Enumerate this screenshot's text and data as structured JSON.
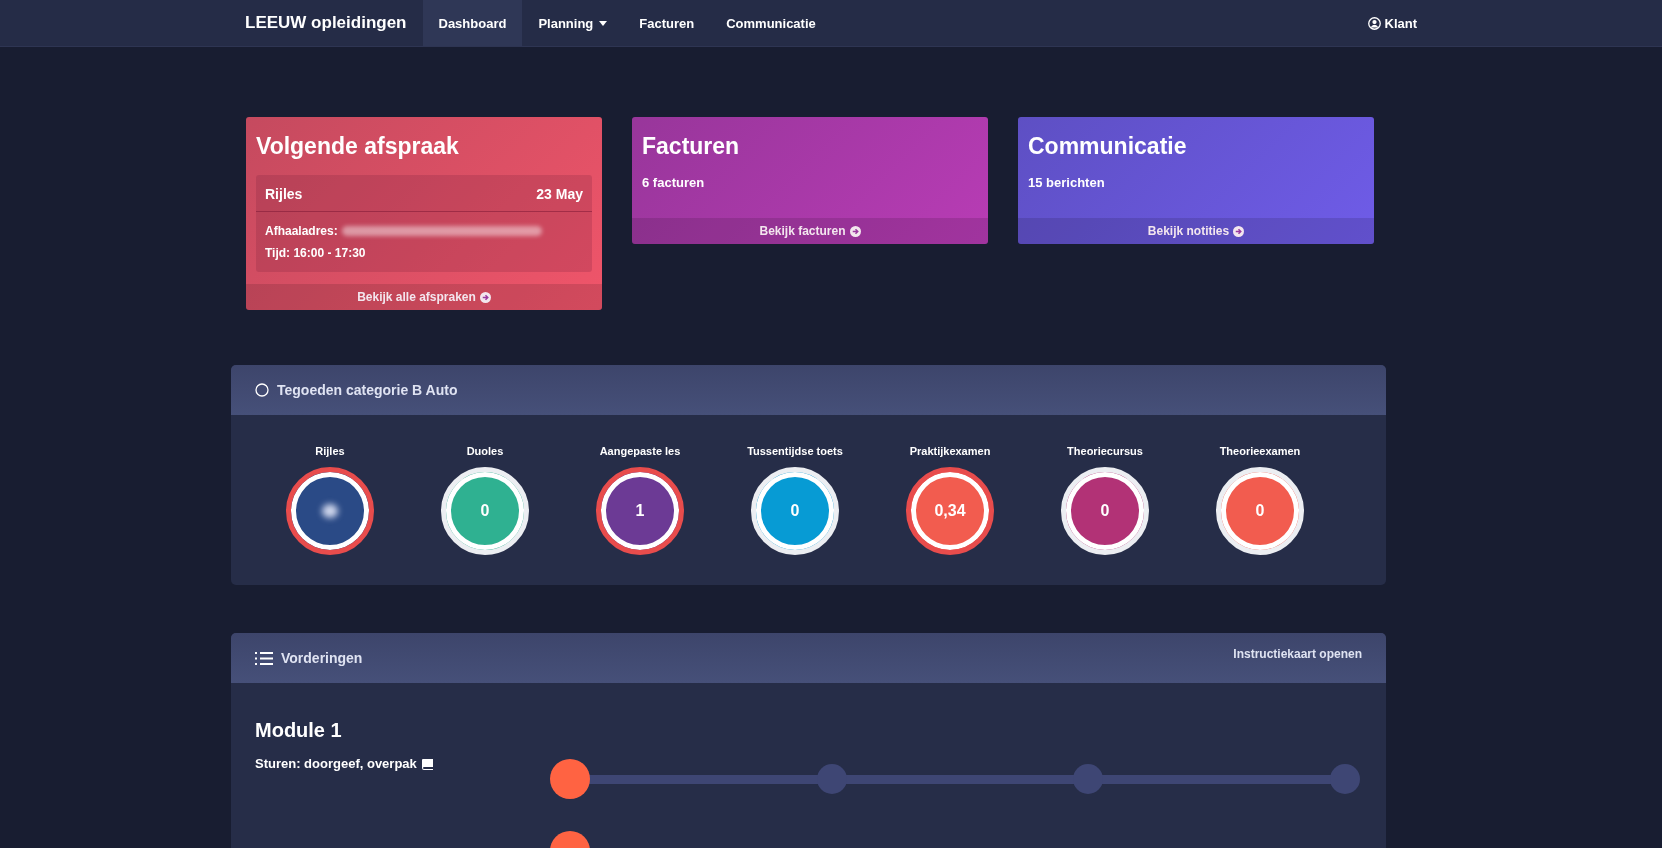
{
  "navbar": {
    "brand": "LEEUW opleidingen",
    "items": [
      {
        "label": "Dashboard",
        "selected": true,
        "dropdown": false
      },
      {
        "label": "Planning",
        "selected": false,
        "dropdown": true
      },
      {
        "label": "Facturen",
        "selected": false,
        "dropdown": false
      },
      {
        "label": "Communicatie",
        "selected": false,
        "dropdown": false
      }
    ],
    "user": "Klant"
  },
  "cards": [
    {
      "kind": "appointment",
      "title": "Volgende afspraak",
      "lesson": "Rijles",
      "date": "23 May",
      "address_label": "Afhaaladres:",
      "time": "Tijd: 16:00 - 17:30",
      "link": "Bekijk alle afspraken",
      "color": "#f0556a"
    },
    {
      "kind": "summary",
      "title": "Facturen",
      "subtitle": "6 facturen",
      "link": "Bekijk facturen",
      "color": "#b83cb5"
    },
    {
      "kind": "summary",
      "title": "Communicatie",
      "subtitle": "15 berichten",
      "link": "Bekijk notities",
      "color": "#6f5ce8"
    }
  ],
  "credits": {
    "title": "Tegoeden categorie B Auto",
    "items": [
      {
        "label": "Rijles",
        "value_blurred": true,
        "color": "#2a4a86",
        "highlighted": true
      },
      {
        "label": "Duoles",
        "value": "0",
        "color": "#2fb191",
        "highlighted": false
      },
      {
        "label": "Aangepaste les",
        "value": "1",
        "color": "#6c3a95",
        "highlighted": true
      },
      {
        "label": "Tussentijdse toets",
        "value": "0",
        "color": "#079bd4",
        "highlighted": false
      },
      {
        "label": "Praktijkexamen",
        "value": "0,34",
        "color": "#f25c4f",
        "highlighted": true
      },
      {
        "label": "Theoriecursus",
        "value": "0",
        "color": "#b23276",
        "highlighted": false
      },
      {
        "label": "Theorieexamen",
        "value": "0",
        "color": "#f25c4f",
        "highlighted": false
      }
    ]
  },
  "progress": {
    "title": "Vorderingen",
    "action": "Instructiekaart openen",
    "modules": [
      {
        "title": "Module 1",
        "rows": [
          {
            "label": "Sturen: doorgeef, overpak",
            "steps": [
              {
                "done": true
              },
              {
                "done": false
              },
              {
                "done": false
              },
              {
                "done": false
              }
            ]
          },
          {
            "steps": [
              {
                "done": true
              }
            ]
          }
        ]
      }
    ]
  }
}
